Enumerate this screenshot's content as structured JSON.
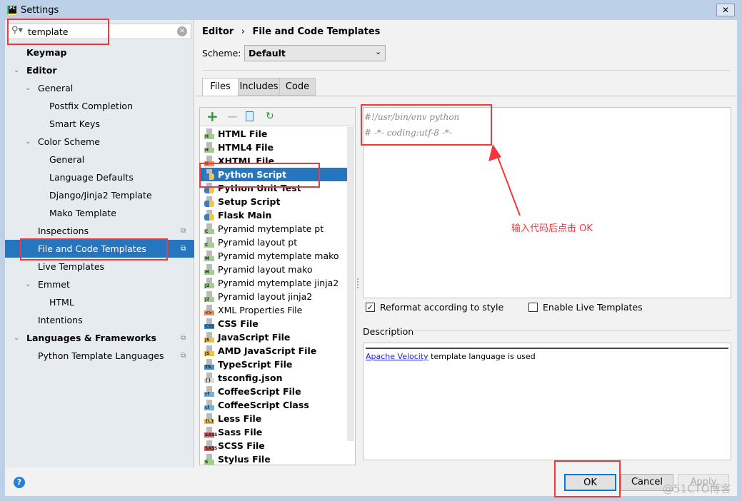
{
  "window": {
    "title": "Settings",
    "app_icon": "pycharm-icon"
  },
  "search": {
    "value": "template"
  },
  "sidebar": {
    "items": [
      {
        "label": "Keymap",
        "bold": true,
        "indent": 0,
        "chevron": false
      },
      {
        "label": "Editor",
        "bold": true,
        "indent": 0,
        "chevron": true
      },
      {
        "label": "General",
        "indent": 1,
        "chevron": true
      },
      {
        "label": "Postfix Completion",
        "indent": 2
      },
      {
        "label": "Smart Keys",
        "indent": 2
      },
      {
        "label": "Color Scheme",
        "indent": 1,
        "chevron": true
      },
      {
        "label": "General",
        "indent": 2
      },
      {
        "label": "Language Defaults",
        "indent": 2
      },
      {
        "label": "Django/Jinja2 Template",
        "indent": 2
      },
      {
        "label": "Mako Template",
        "indent": 2
      },
      {
        "label": "Inspections",
        "indent": 1,
        "copy": true
      },
      {
        "label": "File and Code Templates",
        "indent": 1,
        "copy": true,
        "selected": true
      },
      {
        "label": "Live Templates",
        "indent": 1
      },
      {
        "label": "Emmet",
        "indent": 1,
        "chevron": true
      },
      {
        "label": "HTML",
        "indent": 2
      },
      {
        "label": "Intentions",
        "indent": 1
      },
      {
        "label": "Languages & Frameworks",
        "bold": true,
        "indent": 0,
        "chevron": true,
        "copy": true
      },
      {
        "label": "Python Template Languages",
        "indent": 1,
        "copy": true
      }
    ]
  },
  "breadcrumb": {
    "parent": "Editor",
    "separator": "›",
    "current": "File and Code Templates"
  },
  "scheme": {
    "label": "Scheme:",
    "value": "Default"
  },
  "tabs": [
    {
      "label": "Files",
      "active": true
    },
    {
      "label": "Includes"
    },
    {
      "label": "Code"
    }
  ],
  "files": [
    {
      "name": "HTML File",
      "bold": true,
      "icon": "H",
      "color": "#9fcf8a"
    },
    {
      "name": "HTML4 File",
      "bold": true,
      "icon": "H",
      "color": "#9fcf8a"
    },
    {
      "name": "XHTML File",
      "bold": true,
      "icon": "H",
      "color": "#f08a5a"
    },
    {
      "name": "Python Script",
      "bold": true,
      "icon": "py",
      "selected": true
    },
    {
      "name": "Python Unit Test",
      "bold": true,
      "icon": "py"
    },
    {
      "name": "Setup Script",
      "bold": true,
      "icon": "py"
    },
    {
      "name": "Flask Main",
      "bold": true,
      "icon": "py"
    },
    {
      "name": "Pyramid mytemplate pt",
      "icon": "C",
      "color": "#9fcf8a"
    },
    {
      "name": "Pyramid layout pt",
      "icon": "C",
      "color": "#9fcf8a"
    },
    {
      "name": "Pyramid mytemplate mako",
      "icon": "M",
      "color": "#9fcf8a"
    },
    {
      "name": "Pyramid layout mako",
      "icon": "M",
      "color": "#9fcf8a"
    },
    {
      "name": "Pyramid mytemplate jinja2",
      "icon": "J2",
      "color": "#9fcf8a"
    },
    {
      "name": "Pyramid layout jinja2",
      "icon": "J2",
      "color": "#9fcf8a"
    },
    {
      "name": "XML Properties File",
      "icon": "<>",
      "color": "#f08a5a"
    },
    {
      "name": "CSS File",
      "bold": true,
      "icon": "CSS",
      "color": "#3d8fd6"
    },
    {
      "name": "JavaScript File",
      "bold": true,
      "icon": "JS",
      "color": "#f0c040"
    },
    {
      "name": "AMD JavaScript File",
      "bold": true,
      "icon": "JS",
      "color": "#f0c040"
    },
    {
      "name": "TypeScript File",
      "bold": true,
      "icon": "TS",
      "color": "#3d8fd6"
    },
    {
      "name": "tsconfig.json",
      "bold": true,
      "icon": "{}",
      "color": "#ddd"
    },
    {
      "name": "CoffeeScript File",
      "bold": true,
      "icon": "cf",
      "color": "#6fb0e0"
    },
    {
      "name": "CoffeeScript Class",
      "bold": true,
      "icon": "cf",
      "color": "#6fb0e0"
    },
    {
      "name": "Less File",
      "bold": true,
      "icon": "{L}",
      "color": "#f0c040"
    },
    {
      "name": "Sass File",
      "bold": true,
      "icon": "SASS",
      "color": "#e05a5a"
    },
    {
      "name": "SCSS File",
      "bold": true,
      "icon": "SASS",
      "color": "#e05a5a"
    },
    {
      "name": "Stylus File",
      "bold": true,
      "icon": "S",
      "color": "#9fcf8a"
    }
  ],
  "editor": {
    "lines": [
      "#!/usr/bin/env python",
      "# -*- coding:utf-8 -*-"
    ]
  },
  "annotation": {
    "text": "输入代码后点击 OK",
    "color": "#f0393c"
  },
  "options": {
    "reformat": {
      "label": "Reformat according to style",
      "checked": true
    },
    "live": {
      "label": "Enable Live Templates",
      "checked": false
    }
  },
  "description": {
    "label": "Description",
    "link": "Apache Velocity",
    "text": " template language is used"
  },
  "buttons": {
    "ok": "OK",
    "cancel": "Cancel",
    "apply": "Apply",
    "help": "?"
  },
  "watermark": "@51CTO博客"
}
